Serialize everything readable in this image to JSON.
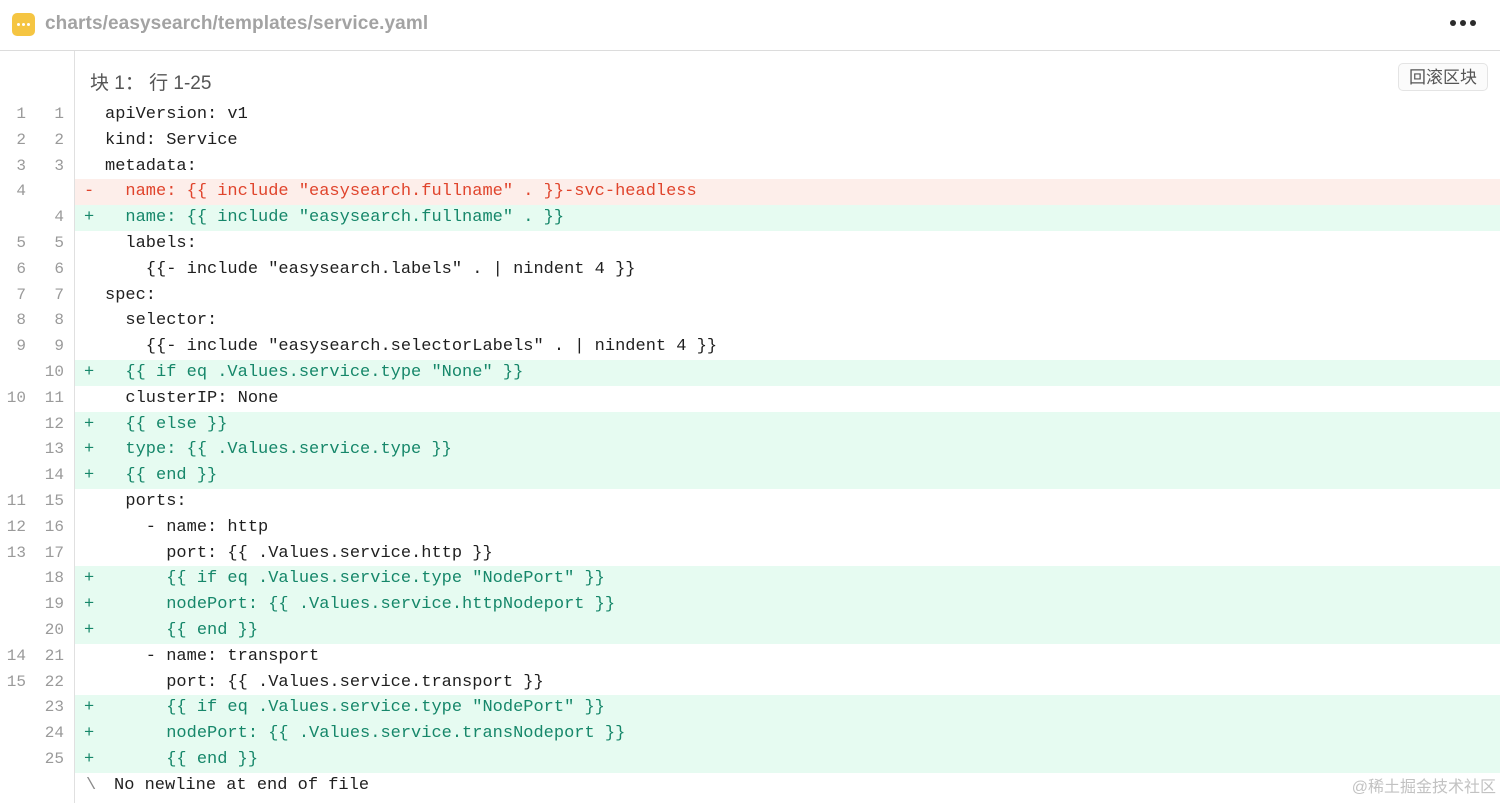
{
  "header": {
    "file_icon": "file-icon",
    "file_path": "charts/easysearch/templates/service.yaml",
    "more_icon": "more-icon"
  },
  "hunk": {
    "header": "块 1： 行 1-25",
    "collapse_label": "回滚区块"
  },
  "lines": [
    {
      "type": "ctx",
      "old": "1",
      "new": "1",
      "marker": "",
      "text": "apiVersion: v1"
    },
    {
      "type": "ctx",
      "old": "2",
      "new": "2",
      "marker": "",
      "text": "kind: Service"
    },
    {
      "type": "ctx",
      "old": "3",
      "new": "3",
      "marker": "",
      "text": "metadata:"
    },
    {
      "type": "del",
      "old": "4",
      "new": "",
      "marker": "-",
      "text": "  name: {{ include \"easysearch.fullname\" . }}-svc-headless"
    },
    {
      "type": "add",
      "old": "",
      "new": "4",
      "marker": "+",
      "text": "  name: {{ include \"easysearch.fullname\" . }}"
    },
    {
      "type": "ctx",
      "old": "5",
      "new": "5",
      "marker": "",
      "text": "  labels:"
    },
    {
      "type": "ctx",
      "old": "6",
      "new": "6",
      "marker": "",
      "text": "    {{- include \"easysearch.labels\" . | nindent 4 }}"
    },
    {
      "type": "ctx",
      "old": "7",
      "new": "7",
      "marker": "",
      "text": "spec:"
    },
    {
      "type": "ctx",
      "old": "8",
      "new": "8",
      "marker": "",
      "text": "  selector:"
    },
    {
      "type": "ctx",
      "old": "9",
      "new": "9",
      "marker": "",
      "text": "    {{- include \"easysearch.selectorLabels\" . | nindent 4 }}"
    },
    {
      "type": "add",
      "old": "",
      "new": "10",
      "marker": "+",
      "text": "  {{ if eq .Values.service.type \"None\" }}"
    },
    {
      "type": "ctx",
      "old": "10",
      "new": "11",
      "marker": "",
      "text": "  clusterIP: None"
    },
    {
      "type": "add",
      "old": "",
      "new": "12",
      "marker": "+",
      "text": "  {{ else }}"
    },
    {
      "type": "add",
      "old": "",
      "new": "13",
      "marker": "+",
      "text": "  type: {{ .Values.service.type }}"
    },
    {
      "type": "add",
      "old": "",
      "new": "14",
      "marker": "+",
      "text": "  {{ end }}"
    },
    {
      "type": "ctx",
      "old": "11",
      "new": "15",
      "marker": "",
      "text": "  ports:"
    },
    {
      "type": "ctx",
      "old": "12",
      "new": "16",
      "marker": "",
      "text": "    - name: http"
    },
    {
      "type": "ctx",
      "old": "13",
      "new": "17",
      "marker": "",
      "text": "      port: {{ .Values.service.http }}"
    },
    {
      "type": "add",
      "old": "",
      "new": "18",
      "marker": "+",
      "text": "      {{ if eq .Values.service.type \"NodePort\" }}"
    },
    {
      "type": "add",
      "old": "",
      "new": "19",
      "marker": "+",
      "text": "      nodePort: {{ .Values.service.httpNodeport }}"
    },
    {
      "type": "add",
      "old": "",
      "new": "20",
      "marker": "+",
      "text": "      {{ end }}"
    },
    {
      "type": "ctx",
      "old": "14",
      "new": "21",
      "marker": "",
      "text": "    - name: transport"
    },
    {
      "type": "ctx",
      "old": "15",
      "new": "22",
      "marker": "",
      "text": "      port: {{ .Values.service.transport }}"
    },
    {
      "type": "add",
      "old": "",
      "new": "23",
      "marker": "+",
      "text": "      {{ if eq .Values.service.type \"NodePort\" }}"
    },
    {
      "type": "add",
      "old": "",
      "new": "24",
      "marker": "+",
      "text": "      nodePort: {{ .Values.service.transNodeport }}"
    },
    {
      "type": "add",
      "old": "",
      "new": "25",
      "marker": "+",
      "text": "      {{ end }}"
    },
    {
      "type": "nonl",
      "old": "",
      "new": "",
      "marker": "\\",
      "text": "No newline at end of file"
    }
  ],
  "watermark": "@稀土掘金技术社区",
  "colors": {
    "added_bg": "#e6fbf1",
    "added_text": "#16876a",
    "deleted_bg": "#fdeeea",
    "deleted_text": "#e0442c",
    "file_icon": "#f5c542"
  }
}
